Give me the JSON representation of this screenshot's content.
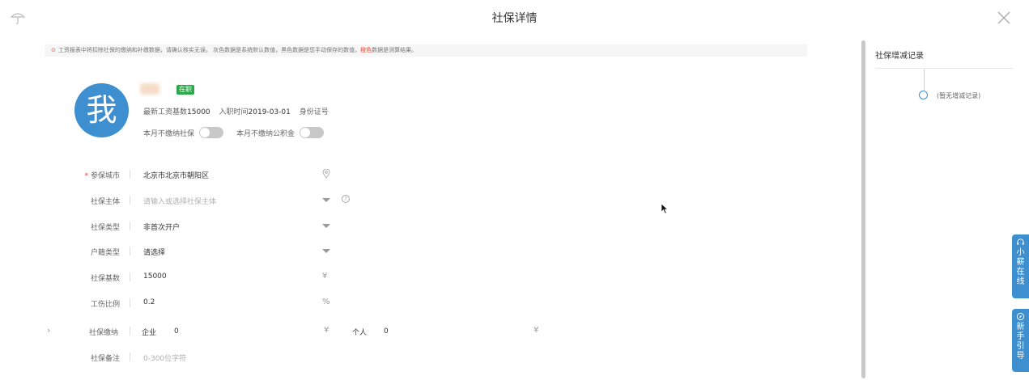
{
  "header": {
    "title": "社保详情",
    "left_icon": "umbrella-icon",
    "close_icon": "close-icon"
  },
  "notice": {
    "icon": "warning-circle-icon",
    "text_part1": "工资报表中将扣除社保的缴纳和补缴数据，请确认核实无误。 灰色数据是系统默认数值，黑色数据是您手动保存的数值，",
    "text_orange": "橙色",
    "text_part2": "数据是测算结果。"
  },
  "employee": {
    "avatar_char": "我",
    "status": "在职",
    "salary_label": "最新工资基数",
    "salary_value": "15000",
    "hire_label": "入职时间",
    "hire_value": "2019-03-01",
    "id_label": "身份证号",
    "toggle_social": "本月不缴纳社保",
    "toggle_fund": "本月不缴纳公积金"
  },
  "form": {
    "city": {
      "label": "参保城市",
      "required_mark": "*",
      "value": "北京市北京市朝阳区",
      "icon": "location-pin-icon"
    },
    "entity": {
      "label": "社保主体",
      "placeholder": "请输入或选择社保主体",
      "icon": "help-icon"
    },
    "type": {
      "label": "社保类型",
      "value": "非首次开户"
    },
    "household": {
      "label": "户籍类型",
      "value": "请选择"
    },
    "base": {
      "label": "社保基数",
      "value": "15000",
      "unit": "¥"
    },
    "injury": {
      "label": "工伤比例",
      "value": "0.2",
      "unit": "%"
    },
    "contribution": {
      "label": "社保缴纳",
      "company_label": "企业",
      "company_value": "0",
      "company_unit": "¥",
      "personal_label": "个人",
      "personal_value": "0",
      "personal_unit": "¥"
    },
    "remark": {
      "label": "社保备注",
      "placeholder": "0-300位字符"
    }
  },
  "records": {
    "title": "社保增减记录",
    "empty_text": "(暂无增减记录)"
  },
  "side_buttons": {
    "online": {
      "icon": "headset-icon",
      "chars": [
        "小",
        "薪",
        "在",
        "线"
      ]
    },
    "guide": {
      "icon": "compass-icon",
      "chars": [
        "新",
        "手",
        "引",
        "导"
      ]
    }
  },
  "colors": {
    "accent": "#3e8fd0",
    "status_green": "#2aa84a",
    "warning_red": "#e04a3a"
  }
}
